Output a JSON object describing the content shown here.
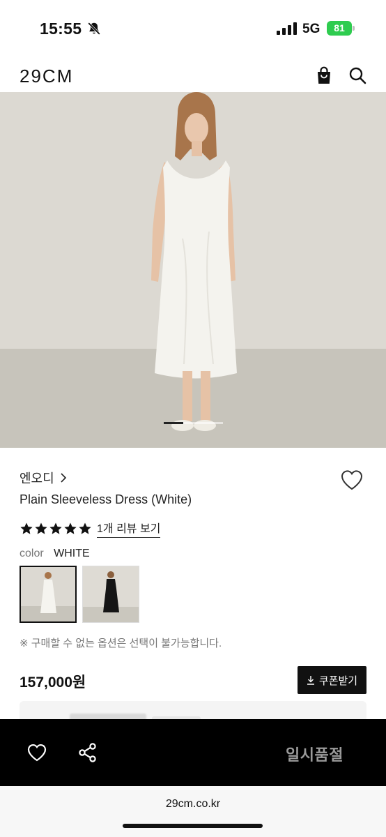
{
  "status_bar": {
    "time": "15:55",
    "network": "5G",
    "battery": "81",
    "icons": [
      "bell-slash-icon",
      "signal-icon",
      "battery-icon"
    ]
  },
  "header": {
    "logo": "29CM",
    "icons": [
      "shopping-bag-icon",
      "search-icon"
    ]
  },
  "carousel": {
    "current": 1,
    "progress": 0.33
  },
  "product": {
    "brand": "엔오디",
    "name": "Plain Sleeveless Dress (White)",
    "rating_stars": 5,
    "review_link": "1개 리뷰 보기",
    "color_label": "color",
    "color_value": "WHITE",
    "color_options": [
      "white",
      "black"
    ],
    "notice": "※ 구매할 수 없는 옵션은 선택이 불가능합니다.",
    "price": "157,000원",
    "coupon_button": "쿠폰받기"
  },
  "action_bar": {
    "icons": [
      "heart-icon",
      "share-icon"
    ],
    "soldout_label": "일시품절"
  },
  "browser": {
    "url": "29cm.co.kr"
  },
  "colors": {
    "accent": "#111111",
    "battery": "#2ecc4f",
    "action_bar_bg": "#000000",
    "soldout_text": "#9a9a9a"
  }
}
